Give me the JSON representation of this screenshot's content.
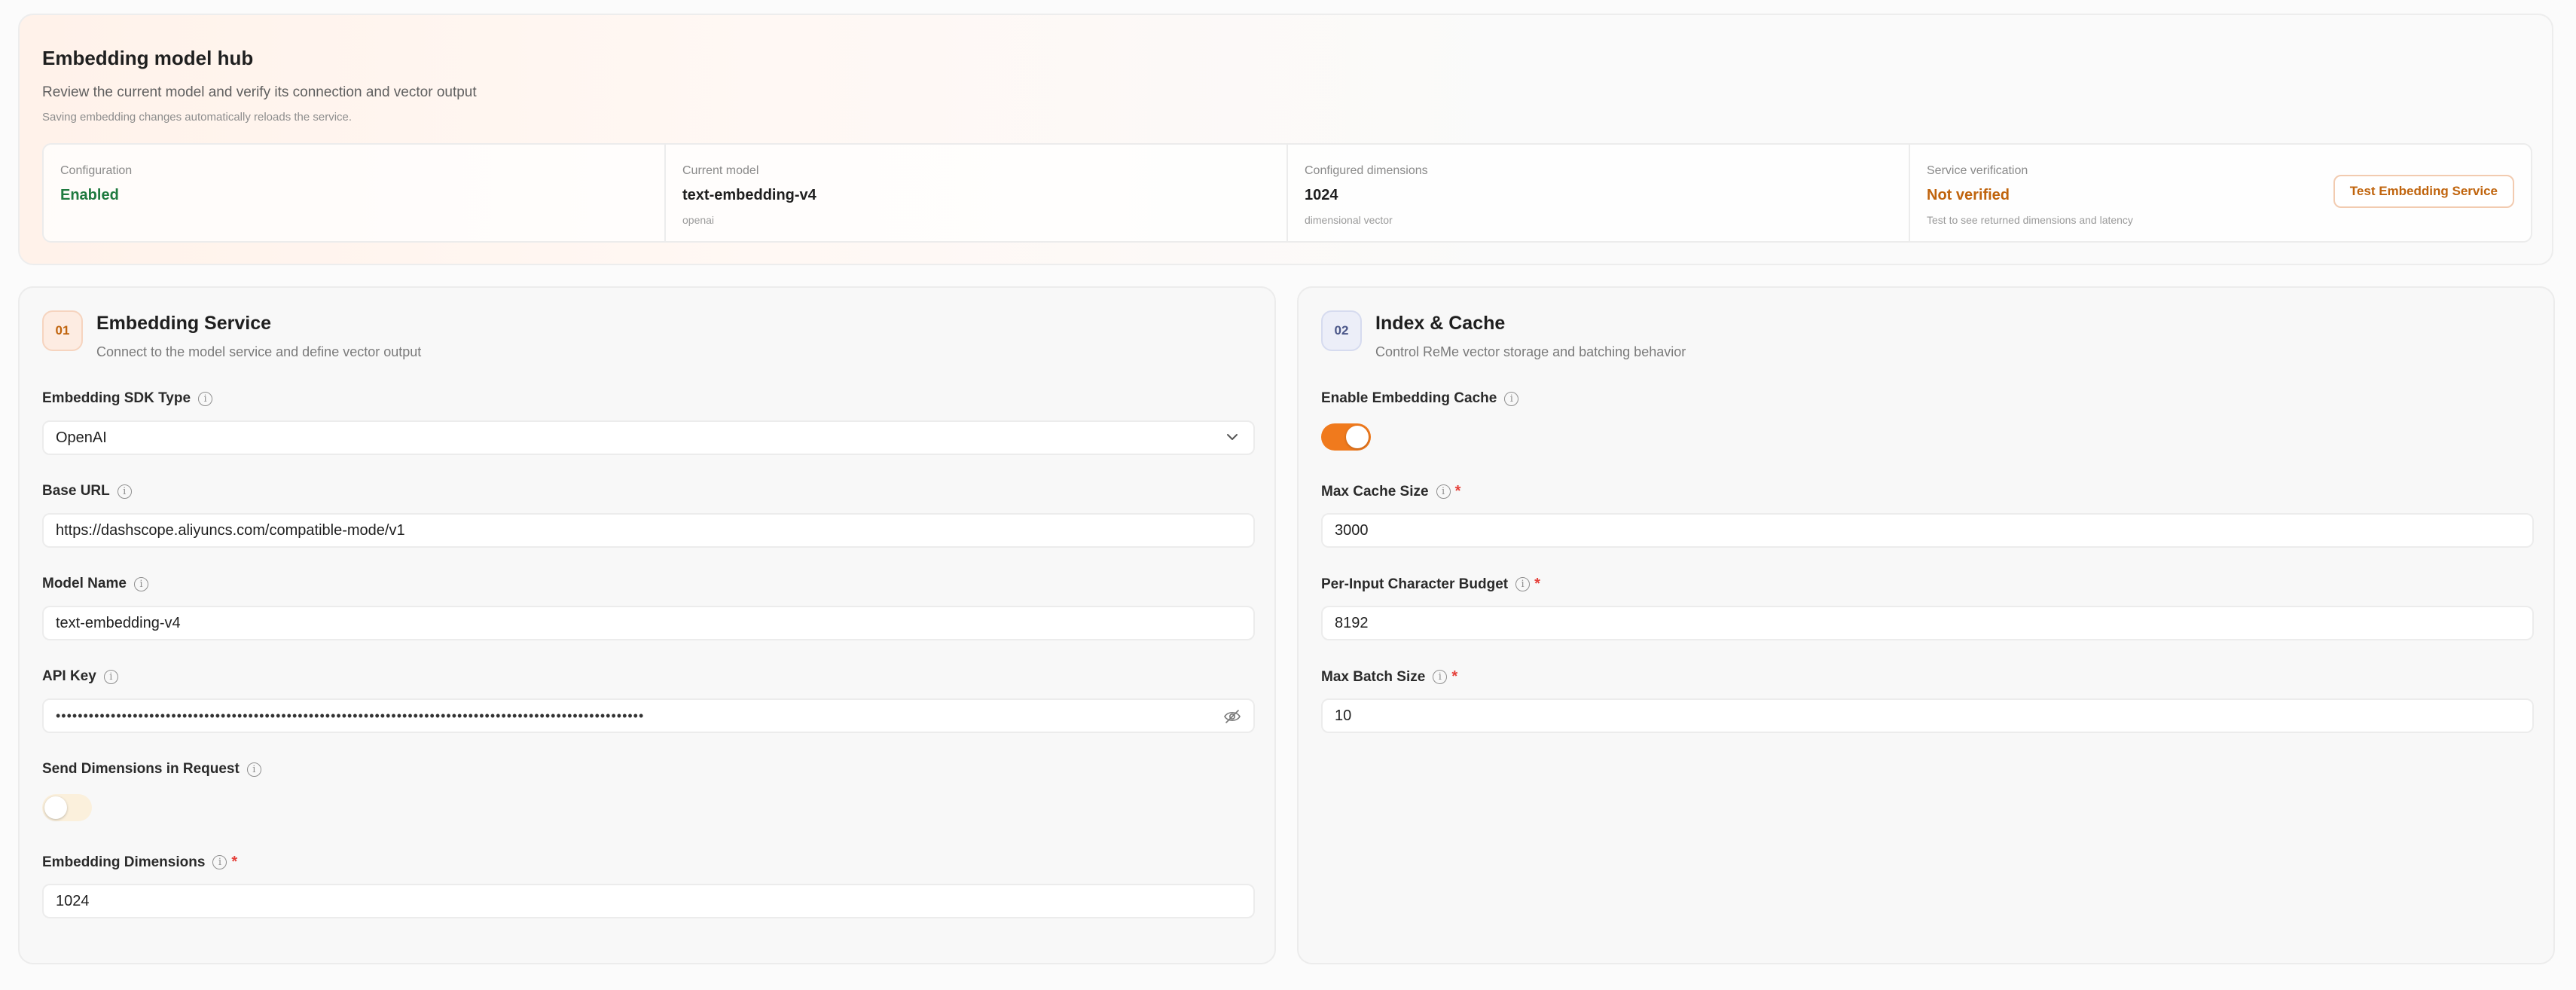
{
  "hub": {
    "title": "Embedding model hub",
    "subtitle": "Review the current model and verify its connection and vector output",
    "note": "Saving embedding changes automatically reloads the service.",
    "stats": {
      "configuration": {
        "label": "Configuration",
        "value": "Enabled"
      },
      "current_model": {
        "label": "Current model",
        "value": "text-embedding-v4",
        "hint": "openai"
      },
      "dimensions": {
        "label": "Configured dimensions",
        "value": "1024",
        "hint": "dimensional vector"
      },
      "verification": {
        "label": "Service verification",
        "value": "Not verified",
        "hint": "Test to see returned dimensions and latency",
        "button": "Test Embedding Service"
      }
    }
  },
  "embedding_service": {
    "badge": "01",
    "title": "Embedding Service",
    "subtitle": "Connect to the model service and define vector output",
    "sdk_type": {
      "label": "Embedding SDK Type",
      "value": "OpenAI"
    },
    "base_url": {
      "label": "Base URL",
      "value": "https://dashscope.aliyuncs.com/compatible-mode/v1"
    },
    "model_name": {
      "label": "Model Name",
      "value": "text-embedding-v4"
    },
    "api_key": {
      "label": "API Key",
      "value": "•••••••••••••••••••••••••••••••••••••••••••••••••••••••••••••••••••••••••••••••••••••••••••••••••••••••••••"
    },
    "send_dimensions": {
      "label": "Send Dimensions in Request",
      "enabled": false
    },
    "embedding_dimensions": {
      "label": "Embedding Dimensions",
      "value": "1024",
      "required": true
    }
  },
  "index_cache": {
    "badge": "02",
    "title": "Index & Cache",
    "subtitle": "Control ReMe vector storage and batching behavior",
    "enable_cache": {
      "label": "Enable Embedding Cache",
      "enabled": true
    },
    "max_cache_size": {
      "label": "Max Cache Size",
      "value": "3000",
      "required": true
    },
    "char_budget": {
      "label": "Per-Input Character Budget",
      "value": "8192",
      "required": true
    },
    "max_batch_size": {
      "label": "Max Batch Size",
      "value": "10",
      "required": true
    }
  },
  "colors": {
    "accent": "#f07a1d",
    "success": "#1f7a3f",
    "warning": "#c0640d",
    "required": "#e5403a"
  },
  "icons": {
    "info": "info-icon",
    "dropdown": "chevron-down-icon",
    "visibility": "eye-off-icon"
  }
}
